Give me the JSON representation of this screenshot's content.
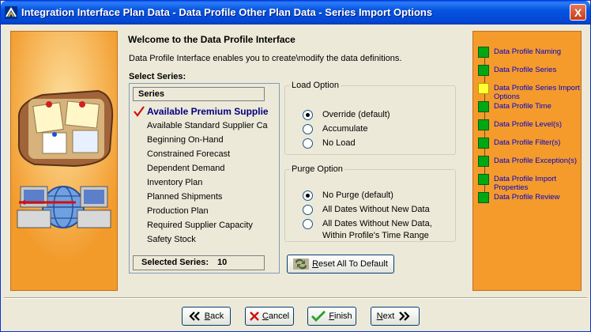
{
  "window": {
    "title": "Integration Interface Plan Data - Data Profile Other Plan Data - Series Import Options",
    "close_label": "X"
  },
  "main": {
    "welcome": "Welcome to the Data Profile Interface",
    "intro": "Data Profile Interface enables you to create\\modify the data definitions.",
    "select_series_label": "Select Series:"
  },
  "series": {
    "header": "Series",
    "items": [
      "Available Premium Supplie",
      "Available Standard Supplier Ca",
      "Beginning On-Hand",
      "Constrained Forecast",
      "Dependent Demand",
      "Inventory Plan",
      "Planned Shipments",
      "Production Plan",
      "Required Supplier Capacity",
      "Safety Stock"
    ],
    "selected_label": "Selected Series:",
    "selected_count": "10"
  },
  "load_option": {
    "legend": "Load Option",
    "options": [
      "Override (default)",
      "Accumulate",
      "No Load"
    ],
    "selected": 0
  },
  "purge_option": {
    "legend": "Purge Option",
    "options": [
      "No Purge (default)",
      "All Dates Without New Data",
      "All Dates Without New Data,\nWithin Profile's Time Range"
    ],
    "option3_line1": "All Dates Without New Data,",
    "option3_line2": "Within Profile's Time Range",
    "selected": 0
  },
  "reset_button": {
    "label_prefix": "R",
    "label_rest": "eset All To Default"
  },
  "steps": [
    {
      "label": "Data Profile Naming",
      "state": "done"
    },
    {
      "label": "Data Profile Series",
      "state": "done"
    },
    {
      "label": "Data Profile Series Import Options",
      "state": "current"
    },
    {
      "label": "Data Profile Time",
      "state": "done"
    },
    {
      "label": "Data Profile Level(s)",
      "state": "done"
    },
    {
      "label": "Data Profile Filter(s)",
      "state": "done"
    },
    {
      "label": "Data Profile Exception(s)",
      "state": "done"
    },
    {
      "label": "Data Profile Import Properties",
      "state": "done"
    },
    {
      "label": "Data Profile Review",
      "state": "done"
    }
  ],
  "nav": {
    "back": {
      "u": "B",
      "rest": "ack"
    },
    "cancel": {
      "u": "C",
      "rest": "ancel"
    },
    "finish": {
      "u": "F",
      "rest": "inish"
    },
    "next": {
      "u": "N",
      "rest": "ext"
    }
  },
  "colors": {
    "accent_orange": "#f59b2c",
    "step_done": "#00a814",
    "step_current": "#ffff33",
    "link_blue": "#0000cc"
  }
}
